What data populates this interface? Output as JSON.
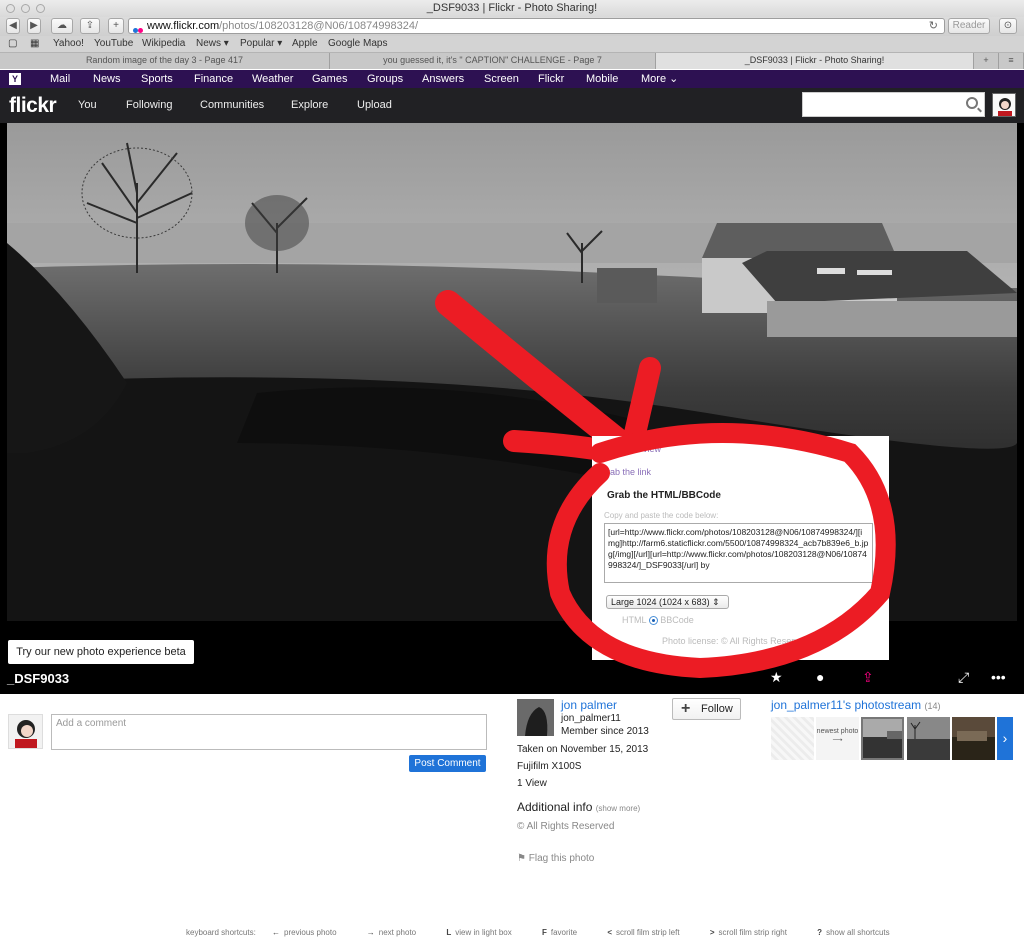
{
  "browser": {
    "window_title": "_DSF9033 | Flickr - Photo Sharing!",
    "url_host": "www.flickr.com",
    "url_path": "/photos/108203128@N06/10874998324/",
    "reader_label": "Reader",
    "bookmarks": [
      "Yahoo!",
      "YouTube",
      "Wikipedia",
      "News ▾",
      "Popular ▾",
      "Apple",
      "Google Maps"
    ],
    "tabs": [
      "Random image of the day 3 - Page 417",
      "you guessed it, it's \" CAPTION\" CHALLENGE - Page 7",
      "_DSF9033 | Flickr - Photo Sharing!"
    ]
  },
  "yahoo_bar": {
    "logo": "Y",
    "items": [
      "Mail",
      "News",
      "Sports",
      "Finance",
      "Weather",
      "Games",
      "Groups",
      "Answers",
      "Screen",
      "Flickr",
      "Mobile",
      "More ⌄"
    ]
  },
  "flickr_nav": {
    "logo": "flickr",
    "items": [
      "You",
      "Following",
      "Communities",
      "Explore",
      "Upload"
    ],
    "search_placeholder": ""
  },
  "photo": {
    "title": "_DSF9033",
    "beta_button": "Try our new photo experience beta"
  },
  "share_popup": {
    "row1": "Share this view",
    "row2": "Grab the link",
    "heading": "Grab the HTML/BBCode",
    "hint": "Copy and paste the code below:",
    "code": "[url=http://www.flickr.com/photos/108203128@N06/10874998324/][img]http://farm6.staticflickr.com/5500/10874998324_acb7b839e6_b.jpg[/img][/url][url=http://www.flickr.com/photos/108203128@N06/10874998324/]_DSF9033[/url] by",
    "size_option": "Large 1024 (1024 x 683)  ⇕",
    "radio_html": "HTML",
    "radio_bbcode": "BBCode",
    "license": "Photo license: © All Rights Reserved"
  },
  "comment": {
    "placeholder": "Add a comment",
    "post_button": "Post Comment"
  },
  "owner": {
    "name": "jon palmer",
    "handle": "jon_palmer11",
    "member_since": "Member since 2013",
    "follow_button": "Follow",
    "taken_on": "Taken on November 15, 2013",
    "camera": "Fujifilm X100S",
    "views": "1 View",
    "additional_info": "Additional info",
    "show_more": "(show more)",
    "rights": "All Rights Reserved",
    "flag": "Flag this photo"
  },
  "photostream": {
    "title": "jon_palmer11's photostream",
    "count": "(14)",
    "newest_label": "newest photo"
  },
  "shortcuts": {
    "label": "keyboard shortcuts:",
    "items": [
      {
        "key": "←",
        "text": "previous photo"
      },
      {
        "key": "→",
        "text": "next photo"
      },
      {
        "key": "L",
        "text": "view in light box"
      },
      {
        "key": "F",
        "text": "favorite"
      },
      {
        "key": "<",
        "text": "scroll film strip left"
      },
      {
        "key": ">",
        "text": "scroll film strip right"
      },
      {
        "key": "?",
        "text": "show all shortcuts"
      }
    ]
  },
  "colors": {
    "yahoo_purple": "#2d1152",
    "flickr_blue": "#1f73d8",
    "flickr_pink": "#ff0084",
    "annotation_red": "#ec1c24"
  }
}
